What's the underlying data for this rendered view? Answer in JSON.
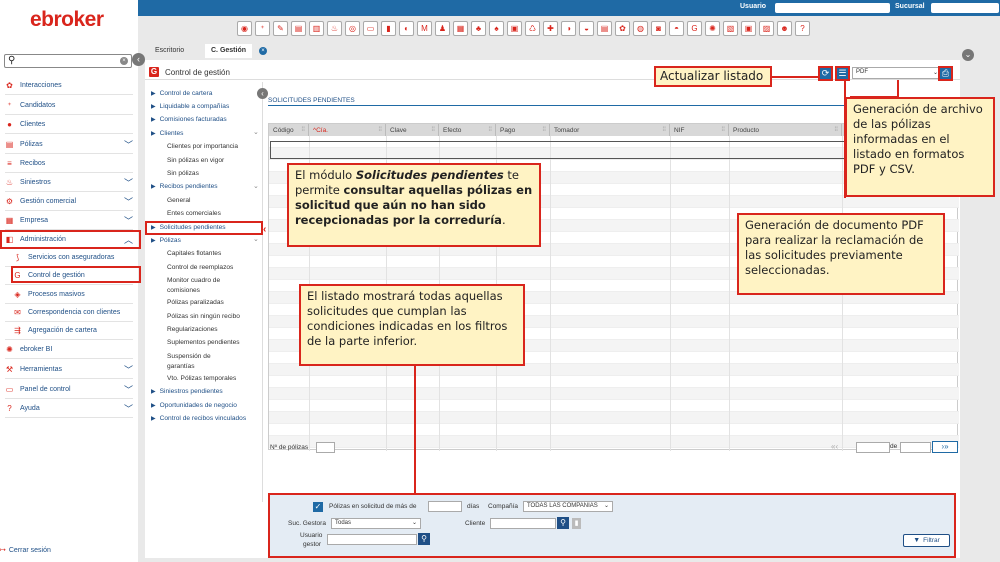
{
  "topbar": {
    "user_label": "Usuario",
    "branch_label": "Sucursal"
  },
  "brand": {
    "logo_text": "ebroker"
  },
  "sidebar": {
    "search_value": "",
    "items": [
      {
        "label": "Interacciones",
        "icon": "handshake-icon",
        "chev": false
      },
      {
        "label": "Candidatos",
        "icon": "add-user-icon",
        "chev": false
      },
      {
        "label": "Clientes",
        "icon": "user-icon",
        "chev": false
      },
      {
        "label": "Pólizas",
        "icon": "policy-icon",
        "chev": true
      },
      {
        "label": "Recibos",
        "icon": "receipt-icon",
        "chev": false
      },
      {
        "label": "Siniestros",
        "icon": "fire-icon",
        "chev": true
      },
      {
        "label": "Gestión comercial",
        "icon": "commercial-icon",
        "chev": true
      },
      {
        "label": "Empresa",
        "icon": "company-icon",
        "chev": true
      },
      {
        "label": "Administración",
        "icon": "admin-icon",
        "chev": true
      },
      {
        "label": "Servicios con aseguradoras",
        "icon": "services-icon",
        "chev": false
      },
      {
        "label": "Control de gestión",
        "icon": "control-icon",
        "chev": false
      },
      {
        "label": "Procesos masivos",
        "icon": "stack-icon",
        "chev": false
      },
      {
        "label": "Correspondencia con clientes",
        "icon": "mail-icon",
        "chev": false
      },
      {
        "label": "Agregación de cartera",
        "icon": "aggregate-icon",
        "chev": false
      },
      {
        "label": "ebroker BI",
        "icon": "bulb-icon",
        "chev": false
      },
      {
        "label": "Herramientas",
        "icon": "tools-icon",
        "chev": true
      },
      {
        "label": "Panel de control",
        "icon": "panel-icon",
        "chev": true
      },
      {
        "label": "Ayuda",
        "icon": "help-icon",
        "chev": true
      }
    ],
    "logout": "Cerrar sesión"
  },
  "tabs": [
    {
      "label": "Escritorio"
    },
    {
      "label": "C. Gestión"
    }
  ],
  "module": {
    "title": "Control de gestión",
    "grid_title": "SOLICITUDES PENDIENTES",
    "format_value": "PDF"
  },
  "tree": [
    {
      "label": "Control de cartera",
      "level": 0,
      "arrow": true
    },
    {
      "label": "Liquidable a compañías",
      "level": 0,
      "arrow": true
    },
    {
      "label": "Comisiones facturadas",
      "level": 0,
      "arrow": true
    },
    {
      "label": "Clientes",
      "level": 0,
      "arrow": true,
      "open": true
    },
    {
      "label": "Clientes por importancia",
      "level": 1
    },
    {
      "label": "Sin pólizas en vigor",
      "level": 1
    },
    {
      "label": "Sin pólizas",
      "level": 1
    },
    {
      "label": "Recibos pendientes",
      "level": 0,
      "arrow": true,
      "open": true
    },
    {
      "label": "General",
      "level": 1
    },
    {
      "label": "Entes comerciales",
      "level": 1
    },
    {
      "label": "Solicitudes pendientes",
      "level": 0,
      "arrow": true
    },
    {
      "label": "Pólizas",
      "level": 0,
      "arrow": true,
      "open": true
    },
    {
      "label": "Capitales flotantes",
      "level": 1
    },
    {
      "label": "Control de reemplazos",
      "level": 1
    },
    {
      "label": "Monitor cuadro de",
      "level": 1
    },
    {
      "label": "comisiones",
      "level": 1
    },
    {
      "label": "Pólizas paralizadas",
      "level": 1
    },
    {
      "label": "Pólizas sin ningún recibo",
      "level": 1
    },
    {
      "label": "Regularizaciones",
      "level": 1
    },
    {
      "label": "Suplementos pendientes",
      "level": 1
    },
    {
      "label": "Suspensión de",
      "level": 1
    },
    {
      "label": "garantías",
      "level": 1
    },
    {
      "label": "Vto. Pólizas temporales",
      "level": 1
    },
    {
      "label": "Siniestros pendientes",
      "level": 0,
      "arrow": true
    },
    {
      "label": "Oportunidades de negocio",
      "level": 0,
      "arrow": true
    },
    {
      "label": "Control de recibos vinculados",
      "level": 0,
      "arrow": true
    }
  ],
  "grid": {
    "columns": [
      "Código",
      "Cía.",
      "Clave",
      "Efecto",
      "Pago",
      "Tomador",
      "NIF",
      "Producto"
    ],
    "footer_label": "Nº de pólizas",
    "pager_of": "de"
  },
  "filters": {
    "check_label": "Pólizas en solicitud de más de",
    "days_label": "días",
    "company_label": "Compañía",
    "company_value": "TODAS LAS COMPAÑIAS",
    "office_label": "Suc. Gestora",
    "office_value": "Todas",
    "client_label": "Cliente",
    "user_label_1": "Usuario",
    "user_label_2": "gestor",
    "filter_button": "Filtrar"
  },
  "callouts": {
    "refresh": "Actualizar listado",
    "export": "Generación de archivo de las pólizas informadas en el listado en formatos PDF y CSV.",
    "pdf": "Generación de documento PDF para realizar la reclamación de las solicitudes previamente seleccionadas.",
    "module_pre": "El módulo ",
    "module_em": "Solicitudes pendientes",
    "module_mid": " te permite ",
    "module_bold": "consultar aquellas pólizas en solicitud que aún no han sido recepcionadas por la correduría",
    "module_end": ".",
    "list": "El listado mostrará todas aquellas solicitudes que cumplan las condiciones indicadas en los filtros de la parte inferior."
  },
  "colors": {
    "accent": "#d9251c",
    "primary": "#1f6aa5",
    "callout_bg": "#fff3c4"
  }
}
